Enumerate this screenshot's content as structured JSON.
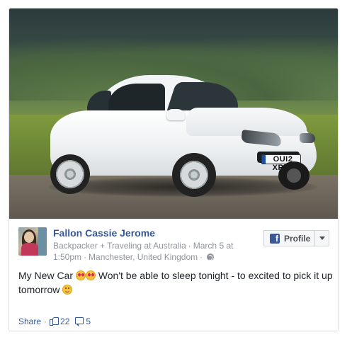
{
  "post": {
    "author": "Fallon Cassie Jerome",
    "bio": "Backpacker + Traveling at Australia",
    "date": "March 5 at 1:50pm",
    "location": "Manchester, United Kingdom",
    "message_part1": "My New Car",
    "message_part2": "Won't be able to sleep tonight - to excited to pick it up tomorrow",
    "photo": {
      "subject": "white hatchback car on gravel in countryside",
      "plate_text": "OUI2 XPG"
    }
  },
  "profile_button": {
    "label": "Profile",
    "icon": "facebook-icon"
  },
  "footer": {
    "share_label": "Share",
    "likes": "22",
    "comments": "5"
  },
  "colors": {
    "link": "#365899",
    "meta": "#90949c",
    "border": "#dddfe2",
    "facebook_blue": "#3b5998"
  }
}
